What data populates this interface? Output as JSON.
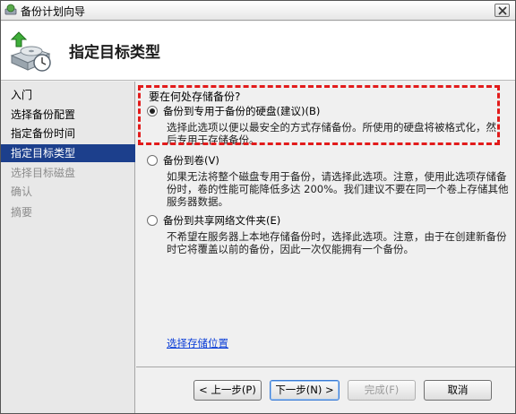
{
  "window": {
    "title": "备份计划向导",
    "close_glyph": "×"
  },
  "header": {
    "title": "指定目标类型",
    "icon": "backup-disk-clock-icon"
  },
  "sidebar": {
    "steps": [
      {
        "label": "入门",
        "state": "normal"
      },
      {
        "label": "选择备份配置",
        "state": "normal"
      },
      {
        "label": "指定备份时间",
        "state": "normal"
      },
      {
        "label": "指定目标类型",
        "state": "active"
      },
      {
        "label": "选择目标磁盘",
        "state": "disabled"
      },
      {
        "label": "确认",
        "state": "disabled"
      },
      {
        "label": "摘要",
        "state": "disabled"
      }
    ]
  },
  "content": {
    "question": "要在何处存储备份?",
    "options": [
      {
        "label": "备份到专用于备份的硬盘(建议)(B)",
        "description": "选择此选项以便以最安全的方式存储备份。所使用的硬盘将被格式化，然后专用于存储备份。",
        "checked": true
      },
      {
        "label": "备份到卷(V)",
        "description": "如果无法将整个磁盘专用于备份，请选择此选项。注意，使用此选项存储备份时，卷的性能可能降低多达 200%。我们建议不要在同一个卷上存储其他服务器数据。",
        "checked": false
      },
      {
        "label": "备份到共享网络文件夹(E)",
        "description": "不希望在服务器上本地存储备份时，选择此选项。注意，由于在创建新备份时它将覆盖以前的备份，因此一次仅能拥有一个备份。",
        "checked": false
      }
    ],
    "link": "选择存储位置"
  },
  "footer": {
    "back": "< 上一步(P)",
    "next": "下一步(N) >",
    "finish": "完成(F)",
    "cancel": "取消"
  },
  "colors": {
    "active_step_bg": "#1c3f8c",
    "highlight_border": "#e21b1b",
    "link": "#0b3ed7"
  }
}
